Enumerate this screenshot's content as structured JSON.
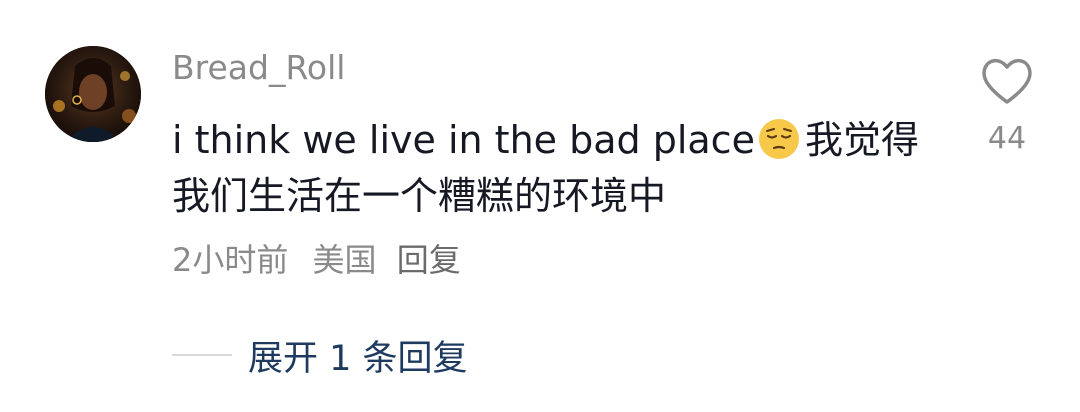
{
  "comment": {
    "avatar_icon": "user-avatar",
    "username": "Bread_Roll",
    "text_before_emoji": "i think we live in the bad place",
    "emoji": "pensive-face-emoji",
    "text_after_emoji": "我觉得\n我们生活在一个糟糕的环境中",
    "time": "2小时前",
    "region": "美国",
    "reply_label": "回复",
    "like_icon": "heart-icon",
    "like_count": "44",
    "expand_replies_label": "展开 1 条回复"
  },
  "colors": {
    "username": "#8a8a8a",
    "text": "#161823",
    "meta": "#8a8a8a",
    "link": "#1e3a5f",
    "divider": "#d9d9d9"
  }
}
